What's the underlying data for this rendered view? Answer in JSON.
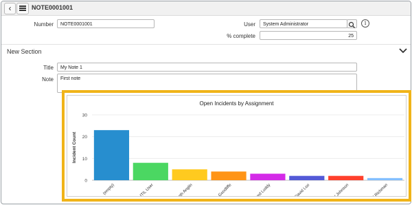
{
  "header": {
    "back_icon": "chevron-left-icon",
    "menu_icon": "hamburger-icon",
    "record_title": "NOTE0001001"
  },
  "form": {
    "number": {
      "label": "Number",
      "value": "NOTE0001001"
    },
    "user": {
      "label": "User",
      "value": "System Administrator",
      "lookup_icon": "search-icon",
      "info_icon": "info-icon"
    },
    "percent_complete": {
      "label": "% complete",
      "value": "25"
    }
  },
  "section": {
    "title": "New Section",
    "toggle_icon": "chevron-down-icon",
    "title_field": {
      "label": "Title",
      "value": "My Note 1"
    },
    "note_field": {
      "label": "Note",
      "value": "First note"
    }
  },
  "colors": {
    "highlight_border": "#f0b419"
  },
  "chart_data": {
    "type": "bar",
    "title": "Open Incidents by Assignment",
    "xlabel": "",
    "ylabel": "Incident Count",
    "ylim": [
      0,
      30
    ],
    "yticks": [
      0,
      10,
      20,
      30
    ],
    "grid": true,
    "categories": [
      "(empty)",
      "ITIL User",
      "Beth Anglin",
      "Don Goodliffe",
      "Fred Luddy",
      "David Loo",
      "Bernard Johnson",
      "Bud Richman"
    ],
    "tick_labels": [
      "(empty)",
      "ITIL User",
      "Beth Anglin",
      "Don Goodliffe",
      "Fred Luddy",
      "David Loo",
      "nard Johnson",
      "Bud Richman"
    ],
    "values": [
      23,
      8,
      5,
      4,
      3,
      2,
      2,
      1
    ],
    "bar_colors": [
      "#278ecf",
      "#4bd762",
      "#ffca1f",
      "#ff9416",
      "#d42ae8",
      "#535ad7",
      "#ff402c",
      "#83bfff"
    ]
  }
}
